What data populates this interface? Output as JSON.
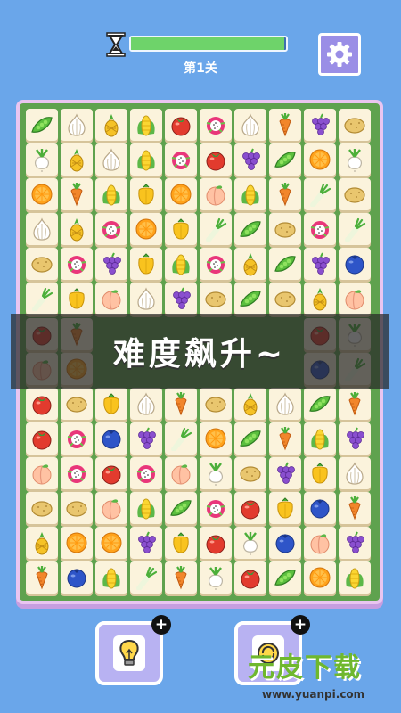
{
  "header": {
    "timer_icon": "hourglass-icon",
    "time_progress": 0.99,
    "level_label": "第1关",
    "settings_icon": "gear-icon"
  },
  "banner": {
    "text": "难度飙升~"
  },
  "tools": {
    "hint_icon": "lightbulb-icon",
    "shuffle_icon": "shuffle-icon",
    "plus_label": "+"
  },
  "watermark": {
    "title": "元皮下载",
    "url": "www.yuanpi.com"
  },
  "colors": {
    "background": "#6aa6ea",
    "board": "#5fa24e",
    "tile": "#fbf3dc",
    "banner": "#282828"
  },
  "board": {
    "rows": [
      [
        "peas",
        "garlic",
        "pineapple",
        "corn",
        "tomato",
        "dragonfruit",
        "garlic",
        "carrot",
        "grapes",
        "potato"
      ],
      [
        "radish",
        "pineapple",
        "garlic",
        "corn",
        "dragonfruit",
        "tomato",
        "grapes",
        "peas",
        "orange",
        "radish"
      ],
      [
        "orange",
        "carrot",
        "corn",
        "pepper",
        "orange",
        "peach",
        "corn",
        "carrot",
        "leek",
        "potato"
      ],
      [
        "garlic",
        "pineapple",
        "dragonfruit",
        "orange",
        "pepper",
        "leek",
        "peas",
        "potato",
        "dragonfruit",
        "leek"
      ],
      [
        "potato",
        "dragonfruit",
        "grapes",
        "pepper",
        "corn",
        "dragonfruit",
        "pineapple",
        "peas",
        "grapes",
        "blueberry"
      ],
      [
        "leek",
        "pepper",
        "peach",
        "garlic",
        "grapes",
        "potato",
        "peas",
        "potato",
        "pineapple",
        "peach"
      ],
      [
        "tomato",
        "carrot",
        "",
        "",
        "",
        "",
        "",
        "",
        "tomato",
        "radish"
      ],
      [
        "peach",
        "orange",
        "",
        "",
        "",
        "",
        "",
        "",
        "blueberry",
        "leek"
      ],
      [
        "tomato",
        "potato",
        "pepper",
        "garlic",
        "carrot",
        "potato",
        "pineapple",
        "garlic",
        "peas",
        "carrot"
      ],
      [
        "tomato",
        "dragonfruit",
        "blueberry",
        "grapes",
        "leek",
        "orange",
        "peas",
        "carrot",
        "corn",
        "grapes"
      ],
      [
        "peach",
        "dragonfruit",
        "tomato",
        "dragonfruit",
        "peach",
        "radish",
        "potato",
        "grapes",
        "pepper",
        "garlic"
      ],
      [
        "potato",
        "potato",
        "peach",
        "corn",
        "peas",
        "dragonfruit",
        "tomato",
        "pepper",
        "blueberry",
        "carrot"
      ],
      [
        "pineapple",
        "orange",
        "orange",
        "grapes",
        "pepper",
        "tomato",
        "radish",
        "blueberry",
        "peach",
        "grapes"
      ],
      [
        "carrot",
        "blueberry",
        "corn",
        "leek",
        "carrot",
        "radish",
        "tomato",
        "peas",
        "orange",
        "corn"
      ]
    ]
  }
}
